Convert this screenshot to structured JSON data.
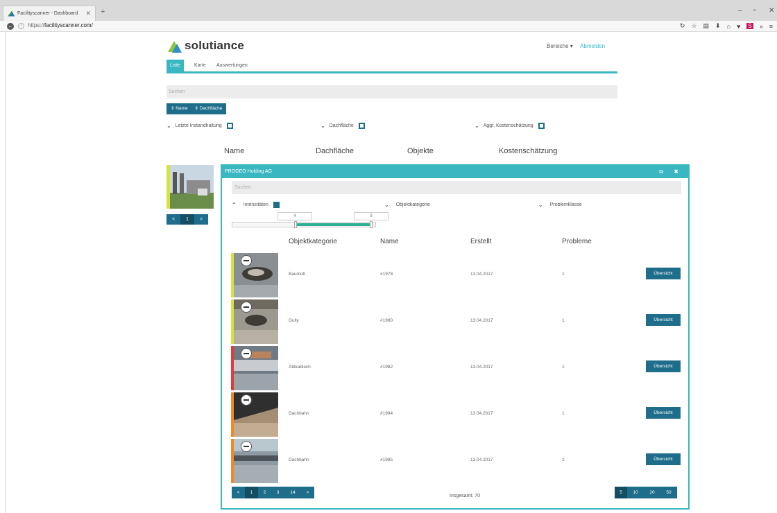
{
  "browser": {
    "tab_title": "Facilityscanner - Dashboard",
    "tab_close": "✕",
    "new_tab": "+",
    "url_prefix": "https://",
    "url_domain": "facilityscanner.com/",
    "minimize": "–",
    "restore": "▫",
    "close": "✕"
  },
  "app": {
    "brand": "solutiance",
    "header_menu": "Bereiche ▾",
    "logout": "Abmelden",
    "tabs": [
      "Liste",
      "Karte",
      "Auswertungen"
    ],
    "search_placeholder": "Suchen",
    "sort_buttons": [
      "⇕ Name",
      "⇕ Dachfläche"
    ],
    "filters": [
      "Letzte Instandhaltung",
      "Dachfläche",
      "Aggr. Kostenschätzung"
    ],
    "columns": [
      "Name",
      "Dachfläche",
      "Objekte",
      "Kostenschätzung"
    ],
    "pager": [
      "<",
      "1",
      ">"
    ]
  },
  "modal": {
    "title": "PROGEO Holding AG",
    "search_placeholder": "Suchen",
    "filters": [
      "Intensitäten",
      "Objektkategorie",
      "Problemklasse"
    ],
    "range_min": "4",
    "range_max": "9",
    "columns": [
      "Objektkategorie",
      "Name",
      "Erstellt",
      "Probleme"
    ],
    "rows": [
      {
        "category": "Baumüll",
        "name": "#1978",
        "created": "13.04.2017",
        "problems": "1",
        "action": "Übersicht",
        "stripe": "#d7e23a"
      },
      {
        "category": "Gully",
        "name": "#1980",
        "created": "13.04.2017",
        "problems": "1",
        "action": "Übersicht",
        "stripe": "#d7e23a"
      },
      {
        "category": "Attikablech",
        "name": "#1982",
        "created": "13.04.2017",
        "problems": "1",
        "action": "Übersicht",
        "stripe": "#e53935"
      },
      {
        "category": "Dachbahn",
        "name": "#1984",
        "created": "13.04.2017",
        "problems": "1",
        "action": "Übersicht",
        "stripe": "#f08a24"
      },
      {
        "category": "Dachbahn",
        "name": "#1985",
        "created": "13.04.2017",
        "problems": "2",
        "action": "Übersicht",
        "stripe": "#f08a24"
      }
    ],
    "pager": [
      "<",
      "1",
      "2",
      "3",
      "14",
      ">"
    ],
    "total": "Insgesamt: 70",
    "page_sizes": [
      "5",
      "10",
      "20",
      "50"
    ]
  },
  "colors": {
    "accent": "#3ab7c1",
    "primary": "#1e6d8a",
    "active": "#144e63"
  }
}
